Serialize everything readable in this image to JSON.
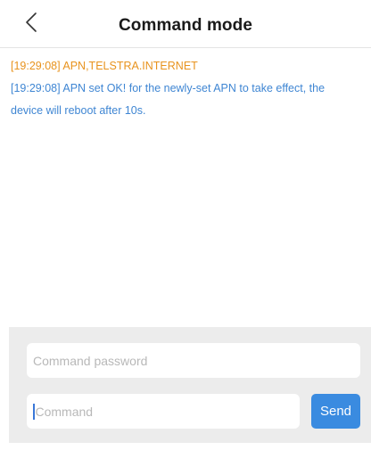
{
  "header": {
    "title": "Command mode",
    "back_icon": "chevron-left-icon"
  },
  "log": {
    "lines": [
      {
        "text": "[19:29:08] APN,TELSTRA.INTERNET",
        "color": "#e8931e"
      },
      {
        "text": "[19:29:08] APN set OK! for the newly-set APN to take effect, the",
        "color": "#3f86d3"
      },
      {
        "text": "device will reboot after 10s.",
        "color": "#3f86d3"
      }
    ]
  },
  "form": {
    "password_placeholder": "Command password",
    "command_placeholder": "Command",
    "send_label": "Send",
    "accent_color": "#3a8be0"
  }
}
